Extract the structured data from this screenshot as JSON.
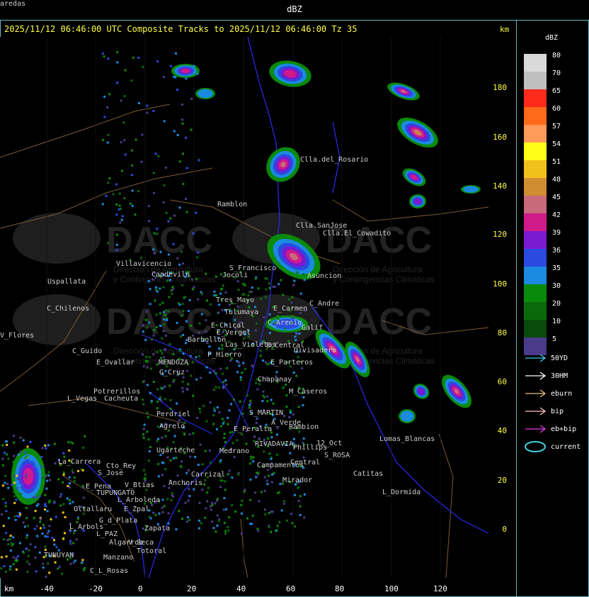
{
  "header": {
    "title": "dBZ"
  },
  "subtitle": "2025/11/12 06:46:00 UTC Composite Tracks to 2025/11/12 06:46:00 Tz 35",
  "km_label_top": "km",
  "km_label_bottom": "km",
  "legend": {
    "title": "dBZ",
    "levels": [
      {
        "label": "80",
        "color": "#d9d9d9"
      },
      {
        "label": "70",
        "color": "#bfbfbf"
      },
      {
        "label": "65",
        "color": "#ff2a1a"
      },
      {
        "label": "60",
        "color": "#ff6a1a"
      },
      {
        "label": "57",
        "color": "#ff9a5a"
      },
      {
        "label": "54",
        "color": "#ffff1a"
      },
      {
        "label": "51",
        "color": "#f2c01a"
      },
      {
        "label": "48",
        "color": "#d08c30"
      },
      {
        "label": "45",
        "color": "#c86a7a"
      },
      {
        "label": "42",
        "color": "#d01a8a"
      },
      {
        "label": "39",
        "color": "#7a1ad0"
      },
      {
        "label": "36",
        "color": "#2a4ae0"
      },
      {
        "label": "35",
        "color": "#1a8ae0"
      },
      {
        "label": "30",
        "color": "#0a8a0a"
      },
      {
        "label": "20",
        "color": "#0a6a0a"
      },
      {
        "label": "10",
        "color": "#0a4a0a"
      },
      {
        "label": "5",
        "color": "#4a3a8a"
      }
    ]
  },
  "tracks": [
    {
      "label": "50YD",
      "color": "#3fd0e0"
    },
    {
      "label": "30HM",
      "color": "#ffffff"
    },
    {
      "label": "eburn",
      "color": "#e8c080"
    },
    {
      "label": "bip",
      "color": "#ffc0c0"
    },
    {
      "label": "eb+bip",
      "color": "#e040e0"
    },
    {
      "label": "current",
      "color": "#3fd0e0"
    }
  ],
  "x_ticks": [
    "-40",
    "-20",
    "0",
    "20",
    "40",
    "60",
    "80",
    "100",
    "120"
  ],
  "y_ticks": [
    "180",
    "160",
    "140",
    "120",
    "100",
    "80",
    "60",
    "40",
    "20",
    "0"
  ],
  "places": [
    {
      "name": "Clla.del_Rosario"
    },
    {
      "name": "Ramblon"
    },
    {
      "name": "Clla.SanJose"
    },
    {
      "name": "Clla.El_Cowadito"
    },
    {
      "name": "Villavicencio"
    },
    {
      "name": "Uspallata"
    },
    {
      "name": "Capdevila"
    },
    {
      "name": "S_Francisco"
    },
    {
      "name": "Jocoli"
    },
    {
      "name": "Asuncion"
    },
    {
      "name": "Tres_Mayo"
    },
    {
      "name": "C_Andre"
    },
    {
      "name": "Tulumaya"
    },
    {
      "name": "E_Carmen"
    },
    {
      "name": "C_Chilenos"
    },
    {
      "name": "E_Chical"
    },
    {
      "name": "E_Vergel"
    },
    {
      "name": "C_Arenio"
    },
    {
      "name": "Galif"
    },
    {
      "name": "Barbollon"
    },
    {
      "name": "Las_Violetas"
    },
    {
      "name": "E_Central"
    },
    {
      "name": "C_Guido"
    },
    {
      "name": "P_Hierro"
    },
    {
      "name": "Divisadero"
    },
    {
      "name": "E_Ovallar"
    },
    {
      "name": "MENDOZA"
    },
    {
      "name": "E_Parteros"
    },
    {
      "name": "G_Cruz"
    },
    {
      "name": "Chapanay"
    },
    {
      "name": "Potrerillos"
    },
    {
      "name": "Cacheuta"
    },
    {
      "name": "L_Vegas"
    },
    {
      "name": "M_Caseros"
    },
    {
      "name": "Perdriel"
    },
    {
      "name": "S_MARTIN"
    },
    {
      "name": "Agrelo"
    },
    {
      "name": "A_Verde"
    },
    {
      "name": "Rambion"
    },
    {
      "name": "E_Peralta"
    },
    {
      "name": "Ugarteche"
    },
    {
      "name": "RIVADAVIA"
    },
    {
      "name": "12_Oct"
    },
    {
      "name": "Phillips"
    },
    {
      "name": "Lomas_Blancas"
    },
    {
      "name": "La_Carrera"
    },
    {
      "name": "Cto_Rey"
    },
    {
      "name": "S_Jose"
    },
    {
      "name": "Medrano"
    },
    {
      "name": "S_ROSA"
    },
    {
      "name": "Campamentos"
    },
    {
      "name": "Central"
    },
    {
      "name": "E_Pena"
    },
    {
      "name": "V_Btias"
    },
    {
      "name": "Anchoris"
    },
    {
      "name": "Carrizal"
    },
    {
      "name": "TUPUNGATO"
    },
    {
      "name": "Catitas"
    },
    {
      "name": "Mirador"
    },
    {
      "name": "L_Arboleda"
    },
    {
      "name": "Gltallaru"
    },
    {
      "name": "E_Zpal"
    },
    {
      "name": "L_Dormida"
    },
    {
      "name": "G_d_Plata"
    },
    {
      "name": "L_Arbols"
    },
    {
      "name": "Zapata"
    },
    {
      "name": "L_PAZ"
    },
    {
      "name": "Algarrob"
    },
    {
      "name": "V_Seca"
    },
    {
      "name": "Totoral"
    },
    {
      "name": "TUNUYAN"
    },
    {
      "name": "Manzano"
    },
    {
      "name": "C_L_Rosas"
    },
    {
      "name": "V_Flores"
    },
    {
      "name": "aredas"
    }
  ],
  "watermark": {
    "brand": "DACC",
    "line1": "Dirección de Agricultura",
    "line2": "y Contingencias Climáticas"
  }
}
